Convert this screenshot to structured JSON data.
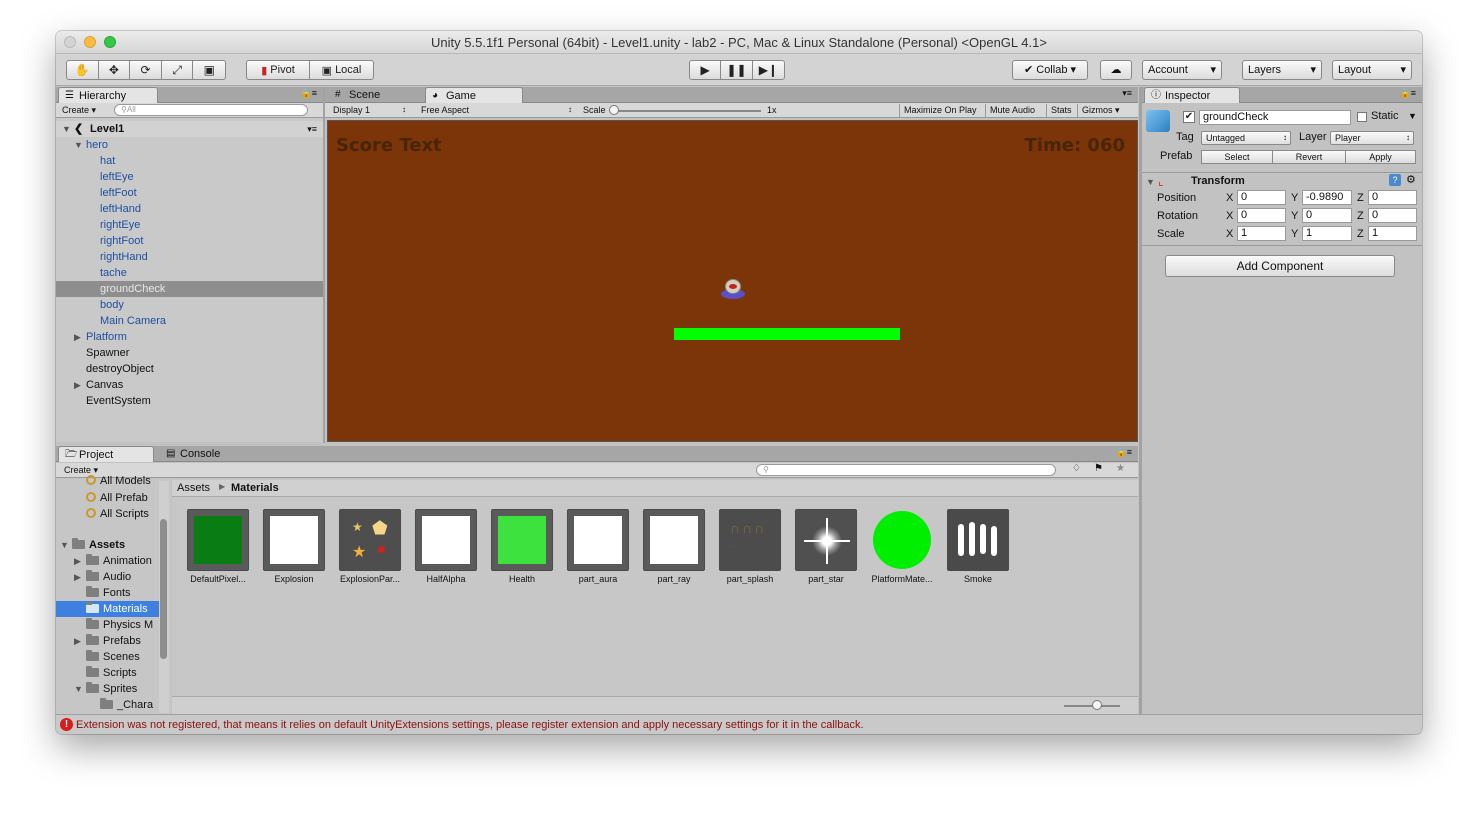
{
  "window": {
    "title": "Unity 5.5.1f1 Personal (64bit) - Level1.unity - lab2 - PC, Mac & Linux Standalone (Personal) <OpenGL 4.1>"
  },
  "toolbar": {
    "pivot": "Pivot",
    "local": "Local",
    "collab": "Collab",
    "account": "Account",
    "layers": "Layers",
    "layout": "Layout"
  },
  "hierarchy": {
    "tab": "Hierarchy",
    "create": "Create",
    "search_placeholder": "All",
    "scene": "Level1",
    "items": [
      "hero",
      "hat",
      "leftEye",
      "leftFoot",
      "leftHand",
      "rightEye",
      "rightFoot",
      "rightHand",
      "tache",
      "groundCheck",
      "body",
      "Main Camera",
      "Platform",
      "Spawner",
      "destroyObject",
      "Canvas",
      "EventSystem"
    ],
    "selected": "groundCheck"
  },
  "scene_tabs": {
    "scene": "Scene",
    "game": "Game"
  },
  "game_bar": {
    "display": "Display 1",
    "aspect": "Free Aspect",
    "scale_label": "Scale",
    "scale_value": "1x",
    "maximize": "Maximize On Play",
    "mute": "Mute Audio",
    "stats": "Stats",
    "gizmos": "Gizmos"
  },
  "game_view": {
    "score_text": "Score Text",
    "time_text": "Time: 060",
    "bg_color": "#7b3508",
    "platform_color": "#00ff00"
  },
  "inspector": {
    "tab": "Inspector",
    "name": "groundCheck",
    "static": "Static",
    "tag_label": "Tag",
    "tag": "Untagged",
    "layer_label": "Layer",
    "layer": "Player",
    "prefab_label": "Prefab",
    "select": "Select",
    "revert": "Revert",
    "apply": "Apply",
    "transform": "Transform",
    "position_label": "Position",
    "rotation_label": "Rotation",
    "scale_label": "Scale",
    "position": {
      "x": "0",
      "y": "-0.9890",
      "z": "0"
    },
    "rotation": {
      "x": "0",
      "y": "0",
      "z": "0"
    },
    "scale": {
      "x": "1",
      "y": "1",
      "z": "1"
    },
    "add_component": "Add Component"
  },
  "project": {
    "tab": "Project",
    "console_tab": "Console",
    "create": "Create",
    "favorites": [
      "All Models",
      "All Prefab",
      "All Scripts"
    ],
    "assets_root": "Assets",
    "folders": [
      "Animation",
      "Audio",
      "Fonts",
      "Materials",
      "Physics M",
      "Prefabs",
      "Scenes",
      "Scripts",
      "Sprites",
      "_Chara"
    ],
    "selected_folder": "Materials",
    "breadcrumb": [
      "Assets",
      "Materials"
    ],
    "assets": [
      "DefaultPixel...",
      "Explosion",
      "ExplosionPar...",
      "HalfAlpha",
      "Health",
      "part_aura",
      "part_ray",
      "part_splash",
      "part_star",
      "PlatformMate...",
      "Smoke"
    ]
  },
  "status": {
    "message": "Extension  was not registered, that means it relies on default UnityExtensions settings, please register extension and apply necessary settings for it in the callback."
  },
  "colors": {
    "selection_blue": "#3d80df",
    "hierarchy_blue": "#1d4f9e",
    "error_red": "#d81b1b"
  }
}
